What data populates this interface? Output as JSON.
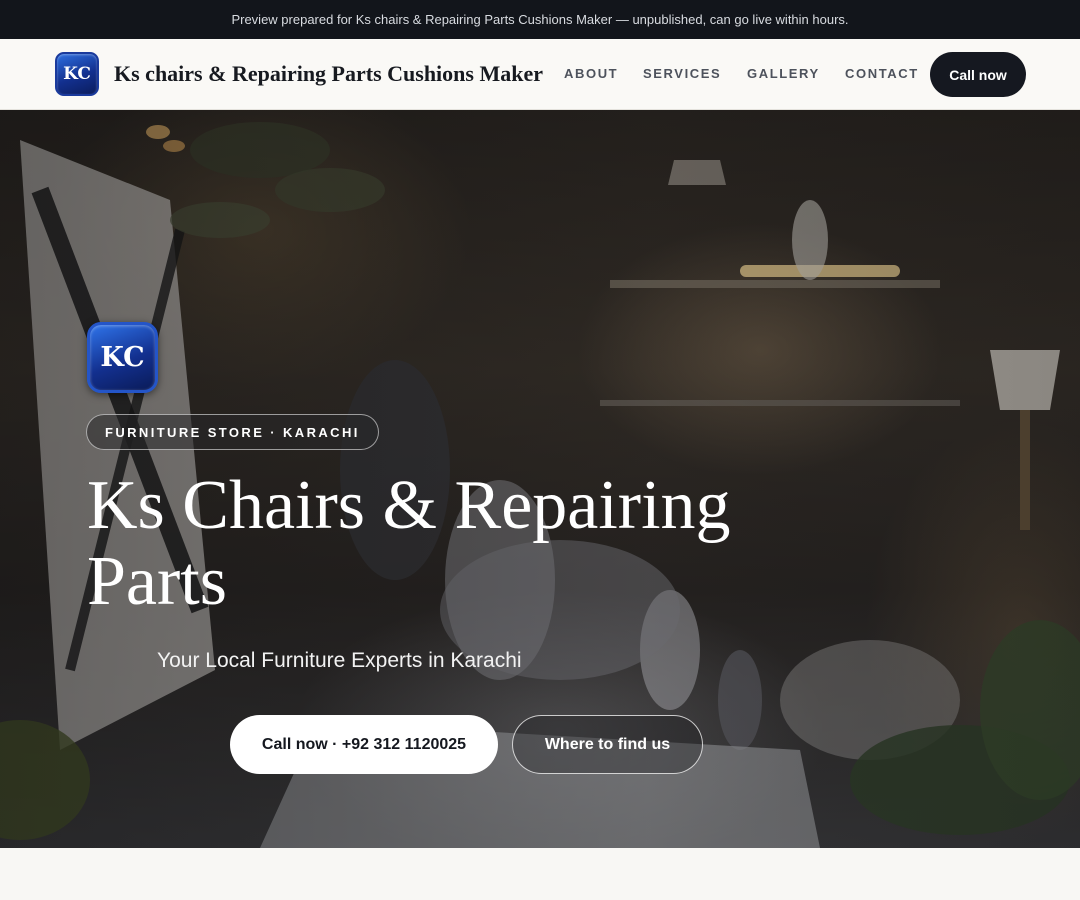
{
  "preview_banner": {
    "text": "Preview prepared for Ks chairs & Repairing Parts Cushions Maker — unpublished, can go live within hours."
  },
  "header": {
    "logo_text": "KC",
    "brand_name": "Ks chairs & Repairing Parts Cushions Maker",
    "nav": {
      "about": "ABOUT",
      "services": "SERVICES",
      "gallery": "GALLERY",
      "contact": "CONTACT"
    },
    "cta_label": "Call now"
  },
  "hero": {
    "logo_text": "KC",
    "badge": "FURNITURE STORE · KARACHI",
    "title": "Ks Chairs & Repairing Parts",
    "subtitle": "Your Local Furniture Experts in Karachi",
    "primary_button": "Call now · +92 312 1120025",
    "secondary_button": "Where to find us"
  },
  "colors": {
    "banner_bg": "#12151b",
    "nav_bg": "#faf9f6",
    "accent_dark": "#151820",
    "logo_blue": "#13308f",
    "page_bg": "#f8f7f4"
  }
}
